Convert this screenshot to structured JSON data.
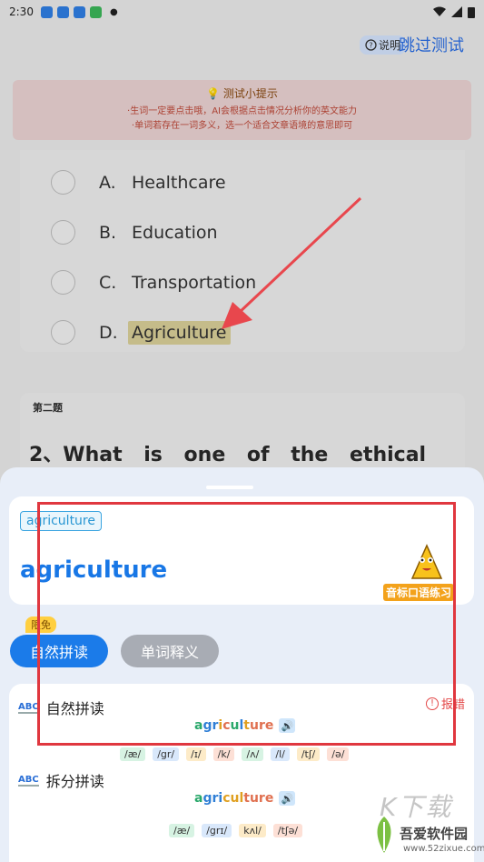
{
  "status_bar": {
    "time": "2:30"
  },
  "header": {
    "help_label": "说明",
    "skip_label": "跳过测试"
  },
  "tips": {
    "title": "测试小提示",
    "lines": [
      "·生词一定要点击哦，AI会根据点击情况分析你的英文能力",
      "·单词若存在一词多义，选一个适合文章语境的意思即可"
    ]
  },
  "question1": {
    "options": [
      {
        "letter": "A.",
        "text": "Healthcare",
        "highlighted": false
      },
      {
        "letter": "B.",
        "text": "Education",
        "highlighted": false
      },
      {
        "letter": "C.",
        "text": "Transportation",
        "highlighted": false
      },
      {
        "letter": "D.",
        "text": "Agriculture",
        "highlighted": true
      }
    ]
  },
  "question2": {
    "tag": "第二题",
    "text": "2、What is one of the ethical"
  },
  "sheet": {
    "chip_word": "agriculture",
    "big_word": "agriculture",
    "promo_label": "音标口语练习",
    "badge": "限免",
    "tabs": [
      {
        "label": "自然拼读",
        "active": true
      },
      {
        "label": "单词释义",
        "active": false
      }
    ],
    "natural": {
      "title": "自然拼读",
      "report_label": "报错",
      "word_parts": [
        {
          "text": "a",
          "color": "#2aa86b"
        },
        {
          "text": "gr",
          "color": "#2f7fd6"
        },
        {
          "text": "i",
          "color": "#e0a020"
        },
        {
          "text": "c",
          "color": "#e07050"
        },
        {
          "text": "u",
          "color": "#2aa86b"
        },
        {
          "text": "l",
          "color": "#2f7fd6"
        },
        {
          "text": "t",
          "color": "#e0a020"
        },
        {
          "text": "ure",
          "color": "#e07050"
        }
      ],
      "phonemes": [
        {
          "text": "/æ/",
          "bg": "#d7f3e3"
        },
        {
          "text": "/gr/",
          "bg": "#d9e8fb"
        },
        {
          "text": "/ɪ/",
          "bg": "#fdebc8"
        },
        {
          "text": "/k/",
          "bg": "#fde0d6"
        },
        {
          "text": "/ʌ/",
          "bg": "#d7f3e3"
        },
        {
          "text": "/l/",
          "bg": "#d9e8fb"
        },
        {
          "text": "/tʃ/",
          "bg": "#fdebc8"
        },
        {
          "text": "/ə/",
          "bg": "#fde0d6"
        }
      ]
    },
    "split": {
      "title": "拆分拼读",
      "word_parts": [
        {
          "text": "a",
          "color": "#2aa86b"
        },
        {
          "text": "gri",
          "color": "#2f7fd6"
        },
        {
          "text": "cul",
          "color": "#e0a020"
        },
        {
          "text": "ture",
          "color": "#e07050"
        }
      ],
      "phonemes": [
        {
          "text": "/æ/",
          "bg": "#d7f3e3"
        },
        {
          "text": "/grɪ/",
          "bg": "#d9e8fb"
        },
        {
          "text": "kʌl/",
          "bg": "#fdebc8"
        },
        {
          "text": "/tʃə/",
          "bg": "#fde0d6"
        }
      ]
    }
  },
  "watermark": {
    "big": "K下载",
    "name": "吾爱软件园",
    "url": "www.52zixue.com"
  }
}
